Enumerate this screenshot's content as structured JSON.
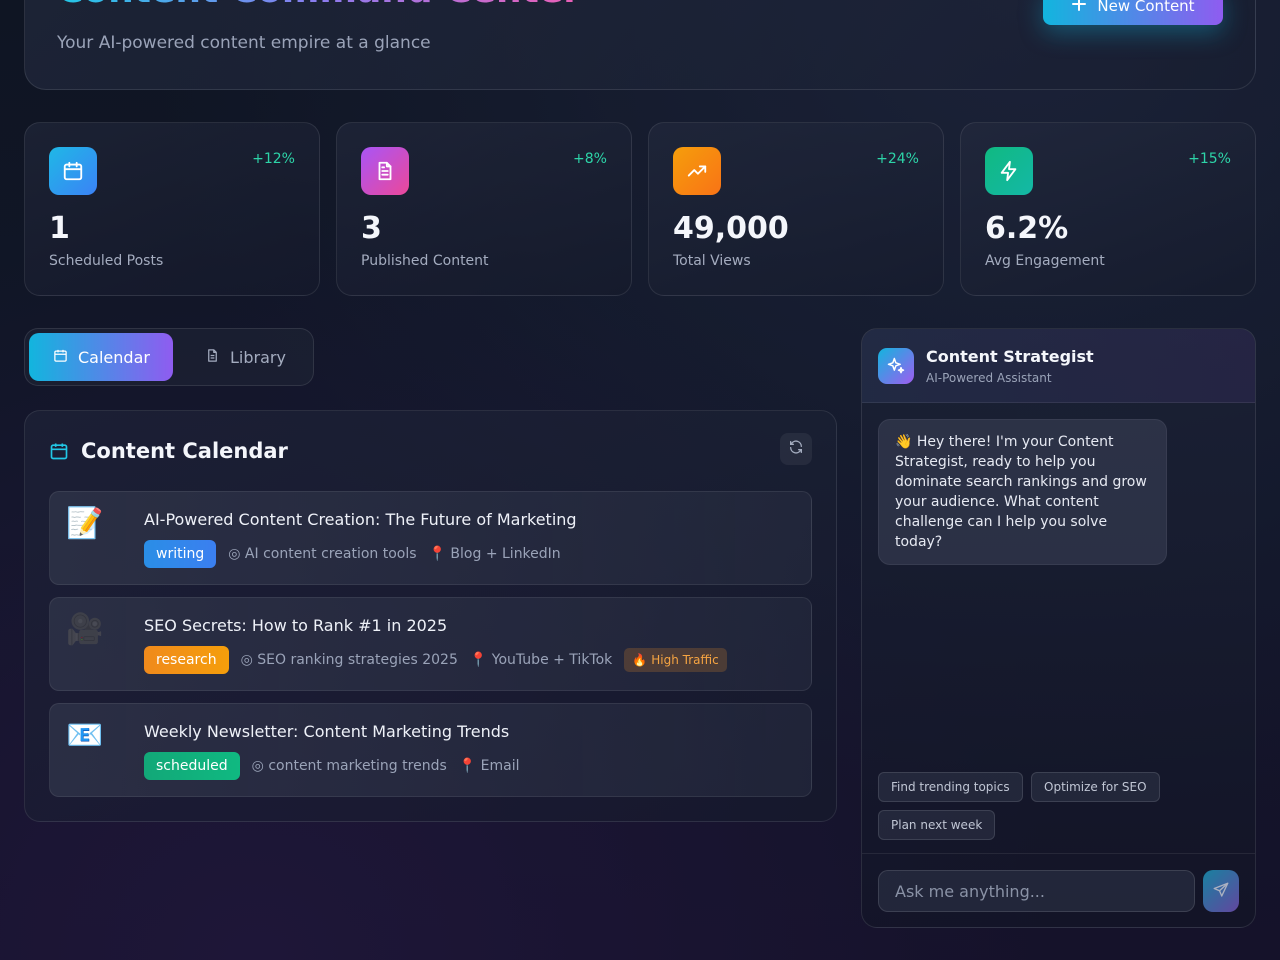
{
  "header": {
    "title": "Content Command Center",
    "subtitle": "Your AI-powered content empire at a glance",
    "new_button_label": "New Content"
  },
  "stats": [
    {
      "value": "1",
      "label": "Scheduled Posts",
      "delta": "+12%",
      "icon": "calendar-icon",
      "color_from": "#1fb8e6",
      "color_to": "#3b82f6"
    },
    {
      "value": "3",
      "label": "Published Content",
      "delta": "+8%",
      "icon": "document-icon",
      "color_from": "#a855f7",
      "color_to": "#ec4899"
    },
    {
      "value": "49,000",
      "label": "Total Views",
      "delta": "+24%",
      "icon": "trending-up-icon",
      "color_from": "#f59e0b",
      "color_to": "#f97316"
    },
    {
      "value": "6.2%",
      "label": "Avg Engagement",
      "delta": "+15%",
      "icon": "lightning-icon",
      "color_from": "#10b981",
      "color_to": "#14b8a6"
    }
  ],
  "tabs": [
    {
      "label": "Calendar",
      "active": true
    },
    {
      "label": "Library",
      "active": false
    }
  ],
  "calendar": {
    "title": "Content Calendar",
    "items": [
      {
        "emoji": "📝",
        "title": "AI-Powered Content Creation: The Future of Marketing",
        "tag": "writing",
        "tag_color": "#2f8fe8",
        "keyword": "AI content creation tools",
        "platform": "Blog + LinkedIn",
        "badge": ""
      },
      {
        "emoji": "🎥",
        "title": "SEO Secrets: How to Rank #1 in 2025",
        "tag": "research",
        "tag_color": "#f08a1c",
        "keyword": "SEO ranking strategies 2025",
        "platform": "YouTube + TikTok",
        "badge": "High Traffic"
      },
      {
        "emoji": "📧",
        "title": "Weekly Newsletter: Content Marketing Trends",
        "tag": "scheduled",
        "tag_color": "#12a878",
        "keyword": "content marketing trends",
        "platform": "Email",
        "badge": ""
      }
    ]
  },
  "strategist": {
    "title": "Content Strategist",
    "subtitle": "AI-Powered Assistant",
    "message": "👋 Hey there! I'm your Content Strategist, ready to help you dominate search rankings and grow your audience. What content challenge can I help you solve today?",
    "chips": [
      "Find trending topics",
      "Optimize for SEO",
      "Plan next week"
    ],
    "input_placeholder": "Ask me anything..."
  },
  "icons": {
    "keyword_prefix": "◎",
    "platform_prefix": "📍",
    "badge_prefix": "🔥"
  }
}
